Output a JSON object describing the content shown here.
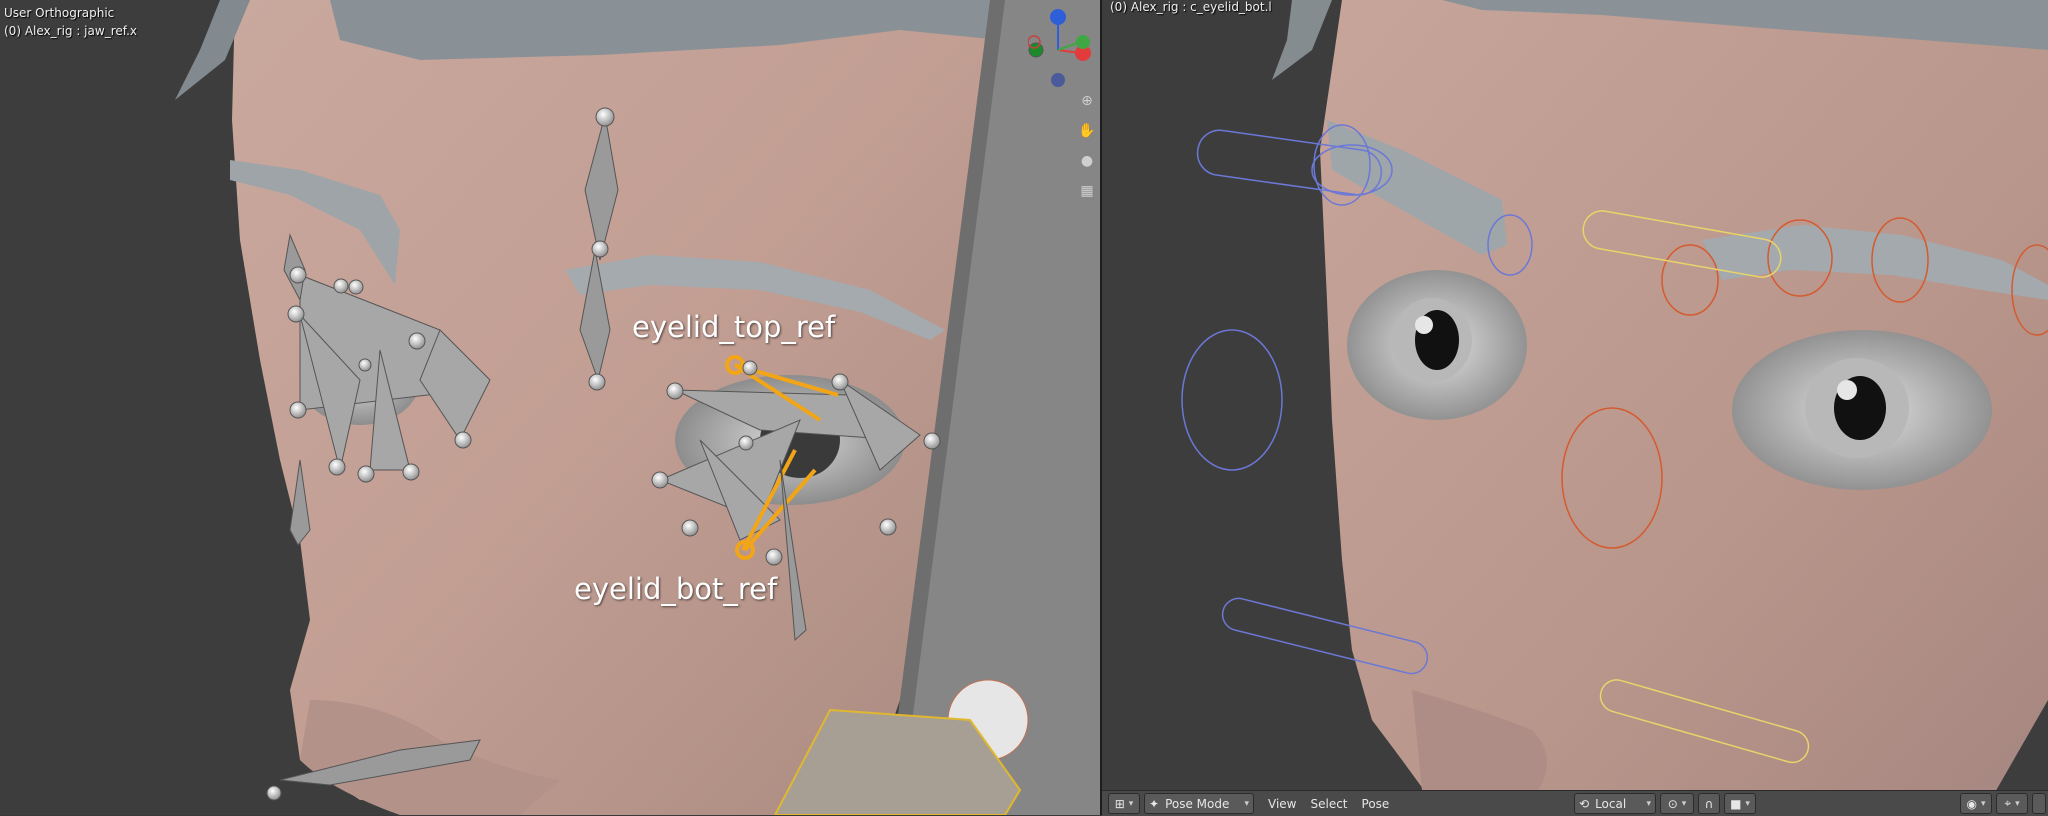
{
  "left_viewport": {
    "view_label": "User Orthographic",
    "object_label": "(0) Alex_rig : jaw_ref.x",
    "annotations": {
      "top": "eyelid_top_ref",
      "bottom": "eyelid_bot_ref"
    },
    "gizmo": {
      "z_label": "Z",
      "x_label": "X",
      "y_label": "Y",
      "colors": {
        "z": "#2f5fd8",
        "x": "#e23b3b",
        "y": "#3fa844"
      }
    },
    "nav_icons": [
      "zoom-icon",
      "hand-icon",
      "camera-icon",
      "grid-icon"
    ],
    "highlight_color": "#f2a516"
  },
  "right_viewport": {
    "object_label": "(0) Alex_rig : c_eyelid_bot.l",
    "header": {
      "mode": "Pose Mode",
      "menus": [
        "View",
        "Select",
        "Pose"
      ],
      "transform_orientation": "Local"
    },
    "control_colors": {
      "blue": "#6b78d6",
      "orange": "#d45a30",
      "yellow": "#e8d46a"
    }
  }
}
